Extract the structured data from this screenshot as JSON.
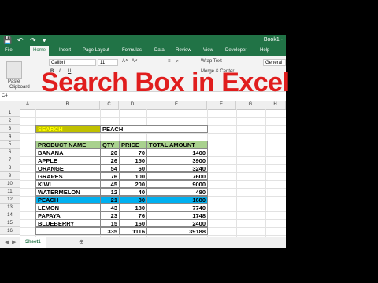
{
  "titlebar": {
    "title": "Book1 -"
  },
  "tabs": [
    "File",
    "Home",
    "Insert",
    "Page Layout",
    "Formulas",
    "Data",
    "Review",
    "View",
    "Developer",
    "Help"
  ],
  "ribbon": {
    "font_name": "Calibri",
    "font_size": "11",
    "wrap_text": "Wrap Text",
    "merge_center": "Merge & Center",
    "number_format": "General",
    "paste_label": "Paste",
    "clipboard_label": "Clipboard",
    "bold": "B",
    "italic": "I",
    "underline": "U"
  },
  "overlay_title": "Search Box in Excel",
  "name_box": "C4",
  "columns": [
    "A",
    "B",
    "C",
    "D",
    "E",
    "F",
    "G",
    "H"
  ],
  "rows": [
    "1",
    "2",
    "3",
    "4",
    "5",
    "6",
    "7",
    "8",
    "9",
    "10",
    "11",
    "12",
    "13",
    "14",
    "15",
    "16"
  ],
  "search": {
    "label": "SEARCH",
    "value": "PEACH"
  },
  "table": {
    "headers": [
      "PRODUCT NAME",
      "QTY",
      "PRICE",
      "TOTAL AMOUNT"
    ],
    "rows": [
      [
        "BANANA",
        "20",
        "70",
        "1400"
      ],
      [
        "APPLE",
        "26",
        "150",
        "3900"
      ],
      [
        "ORANGE",
        "54",
        "60",
        "3240"
      ],
      [
        "GRAPES",
        "76",
        "100",
        "7600"
      ],
      [
        "KIWI",
        "45",
        "200",
        "9000"
      ],
      [
        "WATERMELON",
        "12",
        "40",
        "480"
      ],
      [
        "PEACH",
        "21",
        "80",
        "1680"
      ],
      [
        "LEMON",
        "43",
        "180",
        "7740"
      ],
      [
        "PAPAYA",
        "23",
        "76",
        "1748"
      ],
      [
        "BLUEBERRY",
        "15",
        "160",
        "2400"
      ]
    ],
    "totals": [
      "",
      "335",
      "1116",
      "39188"
    ],
    "highlight_row": 6
  },
  "sheet_tab": "Sheet1",
  "colors": {
    "excel_green": "#217346",
    "header_green": "#a9d18e",
    "highlight_blue": "#00b0f0",
    "search_bg": "#c0c000",
    "title_red": "#e01d1d"
  }
}
